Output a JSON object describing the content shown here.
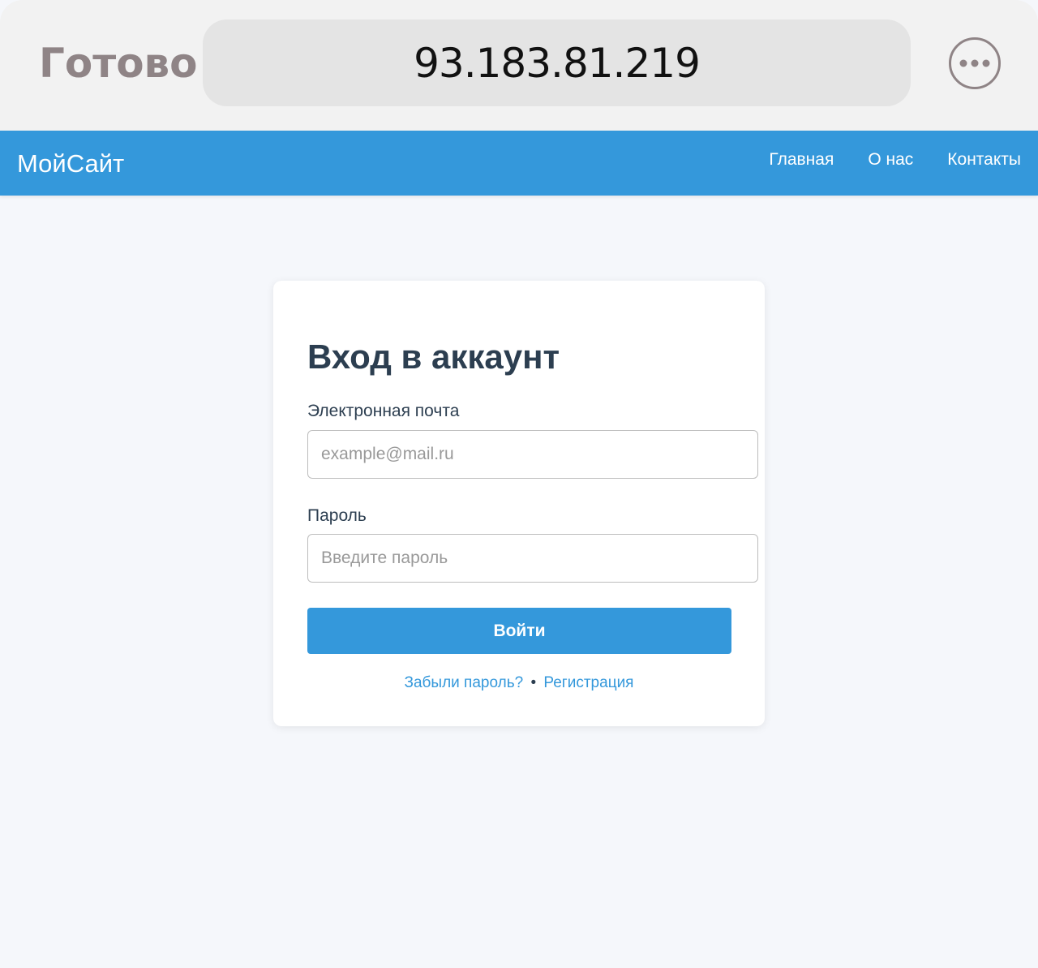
{
  "browser": {
    "done_label": "Готово",
    "address": "93.183.81.219",
    "more_icon": "ellipsis-icon"
  },
  "nav": {
    "logo": "МойСайт",
    "links": [
      "Главная",
      "О нас",
      "Контакты"
    ]
  },
  "login": {
    "title": "Вход в аккаунт",
    "email_label": "Электронная почта",
    "email_placeholder": "example@mail.ru",
    "password_label": "Пароль",
    "password_placeholder": "Введите пароль",
    "submit_label": "Войти",
    "forgot_link": "Забыли пароль?",
    "separator": "•",
    "register_link": "Регистрация"
  },
  "colors": {
    "accent": "#3498db",
    "heading": "#2c3e50",
    "page_bg": "#f5f7fb",
    "browser_bar": "#f2f2f2",
    "done_text": "#8f8486"
  }
}
